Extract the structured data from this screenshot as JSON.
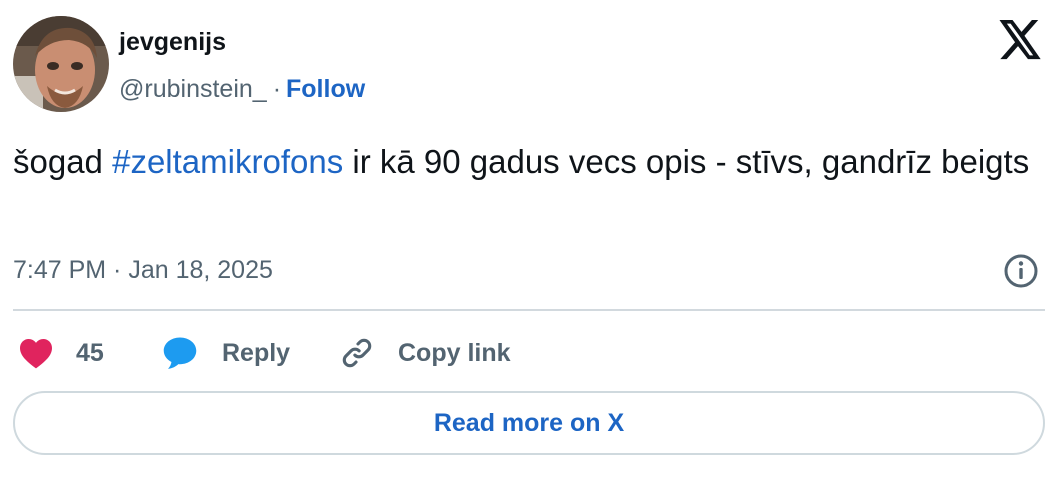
{
  "author": {
    "display_name": "jevgenijs",
    "handle": "@rubinstein_",
    "separator": "·",
    "follow_label": "Follow",
    "avatar_icon": "user-avatar-photo"
  },
  "brand": {
    "logo_icon": "x-logo-icon",
    "link_color": "#1d65c4"
  },
  "tweet": {
    "text_before": "šogad ",
    "hashtag": "#zeltamikrofons",
    "text_after": " ir kā 90 gadus vecs opis - stīvs, gandrīz beigts",
    "timestamp": "7:47 PM · Jan 18, 2025",
    "info_icon": "info-icon"
  },
  "actions": {
    "like_count": "45",
    "like_icon": "heart-icon",
    "like_color": "#e0245e",
    "reply_label": "Reply",
    "reply_icon": "speech-bubble-icon",
    "reply_color": "#1d9bf0",
    "copy_label": "Copy link",
    "copy_icon": "link-icon"
  },
  "read_more": {
    "label": "Read more on X"
  }
}
